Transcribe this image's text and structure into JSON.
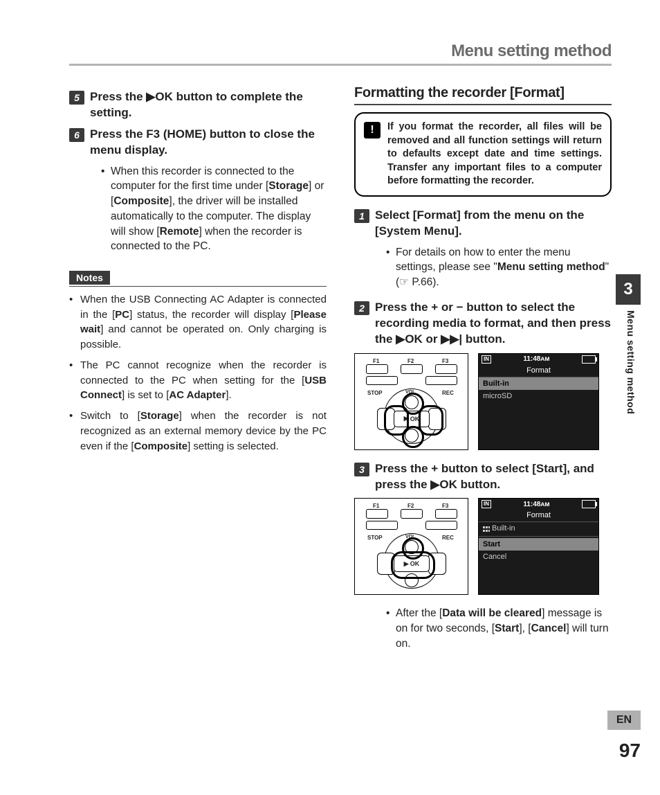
{
  "header": {
    "title": "Menu setting method"
  },
  "side": {
    "chapter": "3",
    "label": "Menu setting method",
    "lang": "EN",
    "page": "97"
  },
  "left": {
    "step5_prefix": "Press the ",
    "step5_ok": "OK",
    "step5_suffix": " button to complete the setting.",
    "step6_prefix": "Press the ",
    "step6_home": "F3 (HOME)",
    "step6_suffix": " button to close the menu display.",
    "bullet1_a": "When this recorder is connected to the computer for the first time under [",
    "bullet1_storage": "Storage",
    "bullet1_b": "] or [",
    "bullet1_composite": "Composite",
    "bullet1_c": "], the driver will be installed automatically to the computer. The display will show [",
    "bullet1_remote": "Remote",
    "bullet1_d": "] when the recorder is connected to the PC.",
    "notes_label": "Notes",
    "note1_a": "When the USB Connecting AC Adapter is connected in the [",
    "note1_pc": "PC",
    "note1_b": "] status, the recorder will display [",
    "note1_wait": "Please wait",
    "note1_c": "] and cannot be operated on. Only charging is possible.",
    "note2_a": "The PC cannot recognize when the recorder is connected to the PC when setting for the [",
    "note2_usb": "USB Connect",
    "note2_b": "] is set to [",
    "note2_ac": "AC Adapter",
    "note2_c": "].",
    "note3_a": "Switch to [",
    "note3_storage": "Storage",
    "note3_b": "] when the recorder is not recognized as an external memory device by the PC even if the [",
    "note3_composite": "Composite",
    "note3_c": "] setting is selected."
  },
  "right": {
    "section_title": "Formatting the recorder [Format]",
    "warning": "If you format the recorder, all files will be removed and all function settings will return to defaults except date and time settings. Transfer any important files to a computer before formatting the recorder.",
    "step1_a": "Select [",
    "step1_format": "Format",
    "step1_b": "] from the menu on the [",
    "step1_sysmenu": "System Menu",
    "step1_c": "].",
    "step1_bullet_a": "For details on how to enter the menu settings, please see \"",
    "step1_bullet_b": "Menu setting method",
    "step1_bullet_c": "\" (☞ P.66).",
    "step2_a": "Press the + or − button to select the recording media to format, and then press the ",
    "step2_ok": "OK",
    "step2_b": " or ",
    "step2_c": " button.",
    "step3_a": "Press the + button to select [Start], and press the ",
    "step3_ok": "OK",
    "step3_b": " button.",
    "afterstep3_a": "After the [",
    "afterstep3_data": "Data will be cleared",
    "afterstep3_b": "] message is on for two seconds, [",
    "afterstep3_start": "Start",
    "afterstep3_c": "], [",
    "afterstep3_cancel": "Cancel",
    "afterstep3_d": "] will turn on."
  },
  "illus": {
    "f1": "F1",
    "f2": "F2",
    "f3": "F3",
    "stop": "STOP",
    "rec": "REC",
    "vol": "VOL",
    "ok": "OK",
    "screen_in": "IN",
    "screen_time": "11:48ᴀᴍ",
    "screen_title": "Format",
    "screen1_rows": [
      "Built-in",
      "microSD"
    ],
    "screen2_intro": "Built-in",
    "screen2_rows": [
      "Start",
      "Cancel"
    ]
  },
  "chart_data": null
}
